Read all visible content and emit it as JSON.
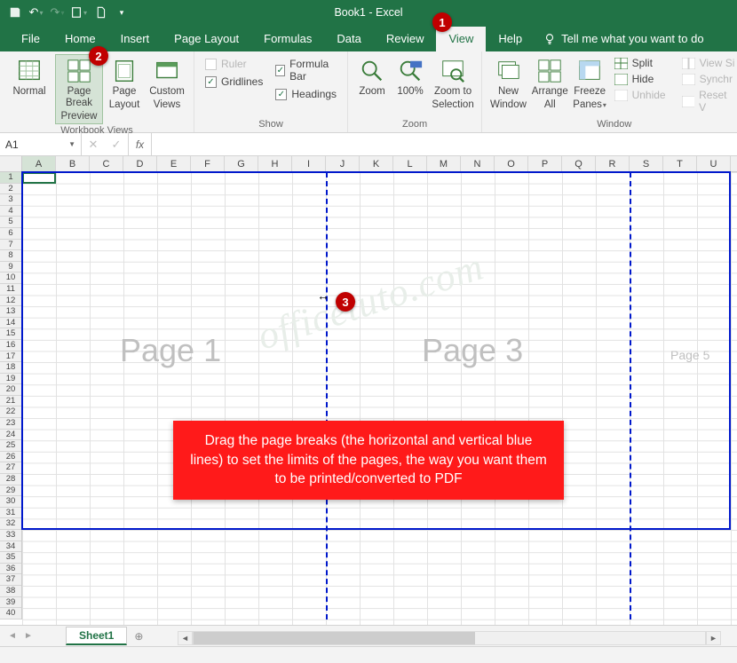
{
  "title": "Book1  -  Excel",
  "qat": {
    "save": "save-icon",
    "undo": "undo-icon",
    "redo": "redo-icon",
    "touch": "touch-icon",
    "new": "new-icon"
  },
  "menu": {
    "file": "File",
    "home": "Home",
    "insert": "Insert",
    "pagelayout": "Page Layout",
    "formulas": "Formulas",
    "data": "Data",
    "review": "Review",
    "view": "View",
    "help": "Help",
    "tellme": "Tell me what you want to do"
  },
  "ribbon": {
    "views": {
      "normal": "Normal",
      "pagebreak_l1": "Page Break",
      "pagebreak_l2": "Preview",
      "pagelayout_l1": "Page",
      "pagelayout_l2": "Layout",
      "custom_l1": "Custom",
      "custom_l2": "Views",
      "group": "Workbook Views"
    },
    "show": {
      "ruler": "Ruler",
      "formulabar": "Formula Bar",
      "gridlines": "Gridlines",
      "headings": "Headings",
      "group": "Show"
    },
    "zoom": {
      "zoom": "Zoom",
      "hundred": "100%",
      "tosel_l1": "Zoom to",
      "tosel_l2": "Selection",
      "group": "Zoom"
    },
    "window": {
      "new_l1": "New",
      "new_l2": "Window",
      "arrange_l1": "Arrange",
      "arrange_l2": "All",
      "freeze_l1": "Freeze",
      "freeze_l2": "Panes",
      "split": "Split",
      "hide": "Hide",
      "unhide": "Unhide",
      "viewside": "View Si",
      "synch": "Synchr",
      "reset": "Reset V",
      "group": "Window"
    }
  },
  "namebox": "A1",
  "fx": "fx",
  "columns": [
    "A",
    "B",
    "C",
    "D",
    "E",
    "F",
    "G",
    "H",
    "I",
    "J",
    "K",
    "L",
    "M",
    "N",
    "O",
    "P",
    "Q",
    "R",
    "S",
    "T",
    "U"
  ],
  "rows": [
    "1",
    "2",
    "3",
    "4",
    "5",
    "6",
    "7",
    "8",
    "9",
    "10",
    "11",
    "12",
    "13",
    "14",
    "15",
    "16",
    "17",
    "18",
    "19",
    "20",
    "21",
    "22",
    "23",
    "24",
    "25",
    "26",
    "27",
    "28",
    "29",
    "30",
    "31",
    "32",
    "33",
    "34",
    "35",
    "36",
    "37",
    "38",
    "39",
    "40"
  ],
  "pages": {
    "p1": "Page 1",
    "p3": "Page 3",
    "p5": "Page 5"
  },
  "watermark": "officetuto.com",
  "callouts": {
    "n1": "1",
    "n2": "2",
    "n3": "3",
    "box": "Drag the page breaks (the horizontal and vertical blue lines) to set the limits of the pages, the way you want them to be printed/converted to PDF"
  },
  "sheet_tab": "Sheet1"
}
